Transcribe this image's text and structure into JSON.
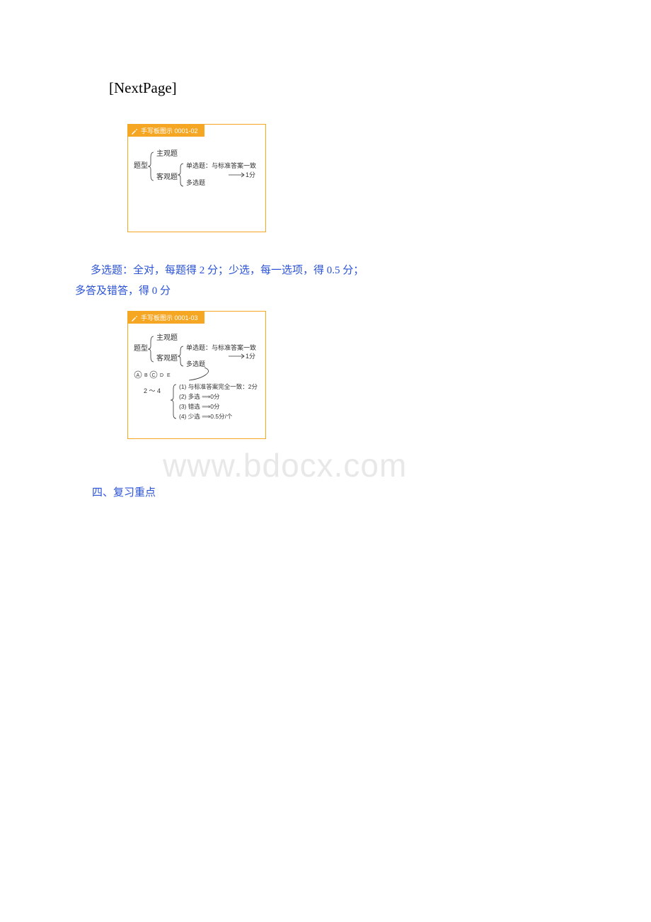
{
  "nextpage_label": "[NextPage]",
  "figure1": {
    "header": "手写板图示 0001-02",
    "root_label": "题型",
    "branch_top": "主观题",
    "branch_bottom": "客观题",
    "leaf_top": "单选题：与标准答案一致",
    "leaf_bottom": "多选题",
    "score_arrow": "→1分"
  },
  "rule_line1": "多选题：全对，每题得 2 分；少选，每一选项，得 0.5 分；",
  "rule_line2": "多答及错答，得 0 分",
  "figure2": {
    "header": "手写板图示 0001-03",
    "root_label": "题型",
    "branch_top": "主观题",
    "branch_bottom": "客观题",
    "leaf_top": "单选题：与标准答案一致",
    "leaf_bottom": "多选题",
    "score_arrow": "→1分",
    "options_a": "A",
    "options_b": "B",
    "options_c": "C",
    "options_d": "D",
    "options_e": "E",
    "range_label": "2 ～ 4",
    "rule1": "(1) 与标准答案完全一致：2分",
    "rule2": "(2) 多选 ⟹0分",
    "rule3": "(3) 错选 ⟹0分",
    "rule4": "(4) 少选 ⟹0.5分/个"
  },
  "section_heading": "四、复习重点",
  "watermark": "www.bdocx.com"
}
